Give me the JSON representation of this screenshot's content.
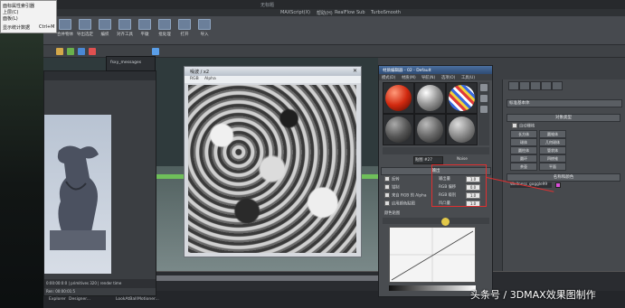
{
  "menu_popup": {
    "items": [
      "面标属性索引器",
      "上层(C)",
      "面板(L)",
      "显示统计数据"
    ],
    "shortcut": "Ctrl+M"
  },
  "max_window": {
    "title_tail": "无标题",
    "menu": [
      "MAXScript(X)",
      "帮助(H)",
      "RealFlow",
      "Sub",
      "TurboSmooth"
    ],
    "ribbon": [
      "合并物体",
      "导出选定",
      "编织",
      "对齐工具",
      "平徽",
      "批处理",
      "打开",
      "导入"
    ],
    "status_items": [
      "Explorer",
      "Designer...",
      "LookAtBall",
      "Motioner..."
    ]
  },
  "slate_window": {
    "title": "fsxy_messages",
    "bottom_text": "0:00:00:0:0 | primitives 320 | render time",
    "status": "Ren: 00:00:01:5"
  },
  "noise_window": {
    "title": "噪波 / x2",
    "tools": [
      "RGB",
      "Alpha"
    ]
  },
  "material_editor": {
    "title": "材质编辑器 - 02 - Default",
    "menu": [
      "模式(D)",
      "材质(M)",
      "导航(N)",
      "选项(O)",
      "工具(U)"
    ],
    "map_name": "贴图 #27",
    "map_type": "Noise",
    "rollout_title": "输出",
    "params": [
      {
        "label": "反转",
        "spin_label": "输出量",
        "value": "1.0"
      },
      {
        "label": "钳制",
        "spin_label": "RGB 偏移",
        "value": "0.0"
      },
      {
        "label": "来自 RGB 的 Alpha",
        "spin_label": "RGB 级别",
        "value": "1.0"
      },
      {
        "label": "启用颜色贴图",
        "spin_label": "凹凸量",
        "value": "1.0"
      }
    ],
    "curve_label": "颜色贴图"
  },
  "command_panel": {
    "dropdown": "标准基本体",
    "header_object_type": "对象类型",
    "auto_grid": "自动栅格",
    "buttons": [
      "长方体",
      "圆锥体",
      "球体",
      "几何球体",
      "圆柱体",
      "管状体",
      "圆环",
      "四棱锥",
      "茶壶",
      "平面"
    ],
    "header_name_color": "名称和颜色",
    "object_name": "Wellness_goggle99"
  },
  "timeline": {
    "frame": "0 / 100"
  },
  "watermark": "头条号 / 3DMAX效果图制作",
  "colors": {
    "accent_red": "#e03030",
    "max_bg": "#3c3f43",
    "title_blue": "#2e4b73"
  }
}
